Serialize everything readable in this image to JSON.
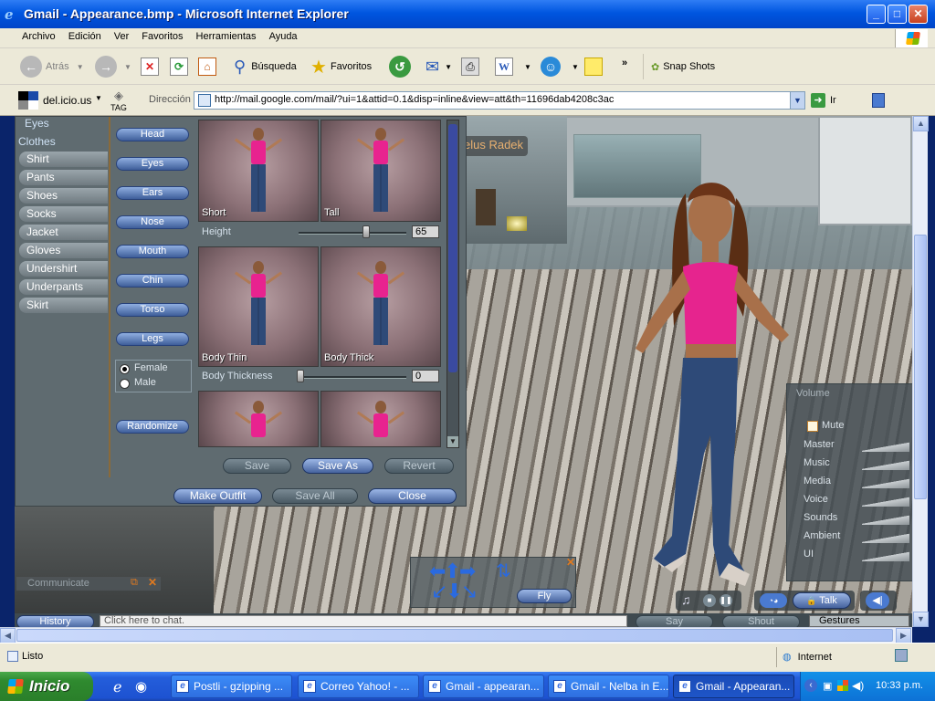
{
  "window": {
    "title": "Gmail - Appearance.bmp - Microsoft Internet Explorer",
    "minimize": "_",
    "maximize": "□",
    "close": "✕"
  },
  "menu": [
    "Archivo",
    "Edición",
    "Ver",
    "Favoritos",
    "Herramientas",
    "Ayuda"
  ],
  "toolbar": {
    "back_label": "Atrás",
    "search_label": "Búsqueda",
    "favorites_label": "Favoritos",
    "snapshots_label": "Snap Shots"
  },
  "addressbar": {
    "delicious_label": "del.icio.us",
    "tag_label": "TAG",
    "address_label": "Dirección",
    "url": "http://mail.google.com/mail/?ui=1&attid=0.1&disp=inline&view=att&th=11696dab4208c3ac",
    "go_label": "Ir"
  },
  "appearance": {
    "categories_top": "Eyes",
    "clothes_label": "Clothes",
    "clothes_items": [
      "Shirt",
      "Pants",
      "Shoes",
      "Socks",
      "Jacket",
      "Gloves",
      "Undershirt",
      "Underpants",
      "Skirt"
    ],
    "body_parts": [
      "Head",
      "Eyes",
      "Ears",
      "Nose",
      "Mouth",
      "Chin",
      "Torso",
      "Legs"
    ],
    "gender": {
      "female": "Female",
      "male": "Male",
      "selected": "female"
    },
    "randomize": "Randomize",
    "thumbs": {
      "short": "Short",
      "tall": "Tall",
      "body_thin": "Body Thin",
      "body_thick": "Body Thick"
    },
    "height": {
      "label": "Height",
      "value": "65"
    },
    "body_thickness": {
      "label": "Body Thickness",
      "value": "0"
    },
    "actions": {
      "save": "Save",
      "save_as": "Save As",
      "revert": "Revert"
    },
    "bottom": {
      "make_outfit": "Make Outfit",
      "save_all": "Save All",
      "close": "Close"
    }
  },
  "scene": {
    "name_tag": "elus Radek",
    "communicate": "Communicate"
  },
  "volume": {
    "title": "Volume",
    "mute": "Mute",
    "channels": [
      "Master",
      "Music",
      "Media",
      "Voice",
      "Sounds",
      "Ambient",
      "UI"
    ]
  },
  "fly": {
    "label": "Fly",
    "close": "✕"
  },
  "sl_bottom": {
    "history": "History",
    "chat_placeholder": "Click here to chat.",
    "say": "Say",
    "shout": "Shout",
    "gestures": "Gestures",
    "talk": "Talk"
  },
  "status": {
    "text": "Listo",
    "zone": "Internet"
  },
  "taskbar": {
    "start": "Inicio",
    "tasks": [
      "Postli - gzipping ...",
      "Correo Yahoo! - ...",
      "Gmail - appearan...",
      "Gmail - Nelba in E...",
      "Gmail - Appearan..."
    ],
    "clock": "10:33 p.m."
  }
}
